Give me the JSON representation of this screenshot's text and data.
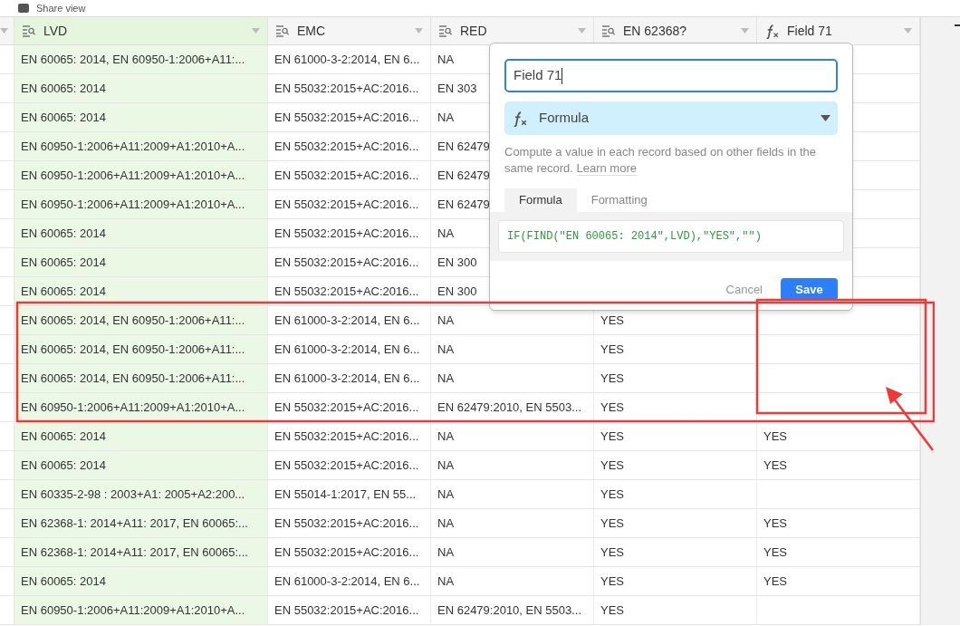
{
  "toolbar": {
    "share_label": "Share view"
  },
  "columns": [
    {
      "label": "LVD",
      "kind": "lookup",
      "highlighted": true
    },
    {
      "label": "EMC",
      "kind": "lookup",
      "highlighted": false
    },
    {
      "label": "RED",
      "kind": "lookup",
      "highlighted": false
    },
    {
      "label": "EN 62368?",
      "kind": "lookup",
      "highlighted": false
    },
    {
      "label": "Field 71",
      "kind": "formula",
      "highlighted": false
    }
  ],
  "rows": [
    {
      "cells": [
        "EN 60065: 2014, EN 60950-1:2006+A11:...",
        "EN 61000-3-2:2014, EN 6...",
        "NA",
        "",
        ""
      ]
    },
    {
      "cells": [
        "EN 60065: 2014",
        "EN 55032:2015+AC:2016...",
        "EN 303",
        "",
        ""
      ]
    },
    {
      "cells": [
        "EN 60065: 2014",
        "EN 55032:2015+AC:2016...",
        "NA",
        "",
        ""
      ]
    },
    {
      "cells": [
        "EN 60950-1:2006+A11:2009+A1:2010+A...",
        "EN 55032:2015+AC:2016...",
        "EN 62479",
        "",
        ""
      ]
    },
    {
      "cells": [
        "EN 60950-1:2006+A11:2009+A1:2010+A...",
        "EN 55032:2015+AC:2016...",
        "EN 62479",
        "",
        ""
      ]
    },
    {
      "cells": [
        "EN 60950-1:2006+A11:2009+A1:2010+A...",
        "EN 55032:2015+AC:2016...",
        "EN 62479",
        "",
        ""
      ]
    },
    {
      "cells": [
        "EN 60065: 2014",
        "EN 55032:2015+AC:2016...",
        "NA",
        "",
        ""
      ]
    },
    {
      "cells": [
        "EN 60065: 2014",
        "EN 55032:2015+AC:2016...",
        "EN 300",
        "",
        ""
      ]
    },
    {
      "cells": [
        "EN 60065: 2014",
        "EN 55032:2015+AC:2016...",
        "EN 300",
        "",
        ""
      ]
    },
    {
      "cells": [
        "EN 60065: 2014, EN 60950-1:2006+A11:...",
        "EN 61000-3-2:2014, EN 6...",
        "NA",
        "YES",
        ""
      ]
    },
    {
      "cells": [
        "EN 60065: 2014, EN 60950-1:2006+A11:...",
        "EN 61000-3-2:2014, EN 6...",
        "NA",
        "YES",
        ""
      ]
    },
    {
      "cells": [
        "EN 60065: 2014, EN 60950-1:2006+A11:...",
        "EN 61000-3-2:2014, EN 6...",
        "NA",
        "YES",
        ""
      ]
    },
    {
      "cells": [
        "EN 60950-1:2006+A11:2009+A1:2010+A...",
        "EN 55032:2015+AC:2016...",
        "EN 62479:2010, EN 5503...",
        "YES",
        ""
      ]
    },
    {
      "cells": [
        "EN 60065: 2014",
        "EN 55032:2015+AC:2016...",
        "NA",
        "YES",
        "YES"
      ]
    },
    {
      "cells": [
        "EN 60065: 2014",
        "EN 55032:2015+AC:2016...",
        "NA",
        "YES",
        "YES"
      ]
    },
    {
      "cells": [
        "EN 60335-2-98 : 2003+A1: 2005+A2:200...",
        "EN 55014-1:2017, EN 55...",
        "NA",
        "YES",
        ""
      ]
    },
    {
      "cells": [
        "EN 62368-1: 2014+A11: 2017, EN 60065:...",
        "EN 55032:2015+AC:2016...",
        "NA",
        "YES",
        "YES"
      ]
    },
    {
      "cells": [
        "EN 62368-1: 2014+A11: 2017, EN 60065:...",
        "EN 55032:2015+AC:2016...",
        "NA",
        "YES",
        "YES"
      ]
    },
    {
      "cells": [
        "EN 60065: 2014",
        "EN 61000-3-2:2014, EN 6...",
        "NA",
        "YES",
        "YES"
      ]
    },
    {
      "cells": [
        "EN 60950-1:2006+A11:2009+A1:2010+A...",
        "EN 55032:2015+AC:2016...",
        "EN 62479:2010, EN 5503...",
        "YES",
        ""
      ]
    }
  ],
  "field_editor": {
    "name_value": "Field 71",
    "type_label": "Formula",
    "description": "Compute a value in each record based on other fields in the same record.",
    "learn_more": "Learn more",
    "tabs": [
      {
        "label": "Formula",
        "selected": true
      },
      {
        "label": "Formatting",
        "selected": false
      }
    ],
    "formula": "IF(FIND(\"EN 60065: 2014\",LVD),\"YES\",\"\")",
    "cancel": "Cancel",
    "save": "Save"
  }
}
